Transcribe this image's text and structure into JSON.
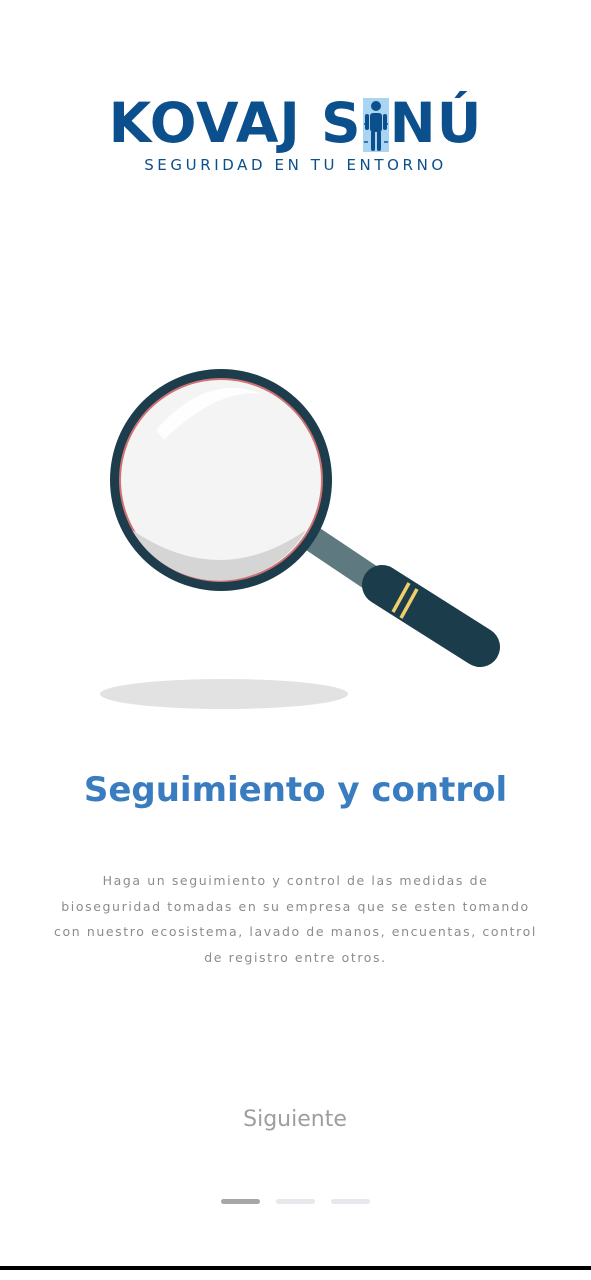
{
  "header": {
    "logo": {
      "word_left": "KOVAJ S",
      "word_right": "NÚ",
      "tagline": "SEGURIDAD EN TU ENTORNO",
      "icon": "person-icon"
    }
  },
  "slide": {
    "illustration": "magnifying-glass-icon",
    "title": "Seguimiento y control",
    "description": "Haga un seguimiento y control de las medidas de bioseguridad tomadas en su empresa que se esten tomando con nuestro ecosistema, lavado de manos, encuentas, control de registro entre otros."
  },
  "footer": {
    "next_label": "Siguiente",
    "pagination": {
      "current": 1,
      "total": 3
    }
  },
  "colors": {
    "brand_dark": "#0b4f8c",
    "brand_figure_bg": "#a9d4f2",
    "title_blue": "#3a7cc0",
    "text_gray": "#8c8c8c",
    "button_gray": "#9e9e9e",
    "dot_active": "#a6a6a6",
    "dot_inactive": "#e8e8ec",
    "lens_rim": "#1e3d4c",
    "handle_dark": "#1a3c4b",
    "stem": "#5e7a80",
    "band": "#f2cd6b",
    "shadow": "#e2e2e2"
  }
}
